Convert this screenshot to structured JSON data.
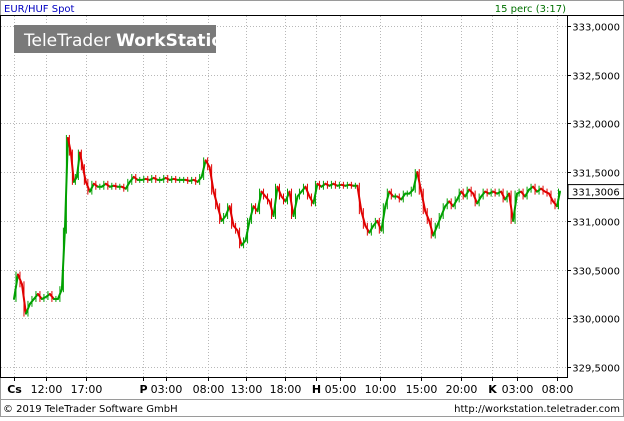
{
  "header": {
    "instrument": "EUR/HUF Spot",
    "interval": "15 perc (3:17)"
  },
  "watermark": {
    "brand_light": "TeleTrader ",
    "brand_bold": "WorkStation"
  },
  "footer": {
    "copyright": "© 2019 TeleTrader Software GmbH",
    "url": "http://workstation.teletrader.com"
  },
  "colors": {
    "up": "#00a000",
    "down": "#e00000",
    "grid": "#b8b8b8",
    "axis": "#000000",
    "header_text_left": "#0000c0",
    "header_text_right": "#007000",
    "watermark_bg": "#7a7a7a",
    "background": "#ffffff"
  },
  "chart_data": {
    "type": "line",
    "title": "EUR/HUF Spot",
    "ylim": [
      329.4,
      333.1
    ],
    "yticks": [
      {
        "value": 333.0,
        "label": "333,0000"
      },
      {
        "value": 332.5,
        "label": "332,5000"
      },
      {
        "value": 332.0,
        "label": "332,0000"
      },
      {
        "value": 331.5,
        "label": "331,5000"
      },
      {
        "value": 331.0,
        "label": "331,0000"
      },
      {
        "value": 330.5,
        "label": "330,5000"
      },
      {
        "value": 330.0,
        "label": "330,0000"
      },
      {
        "value": 329.5,
        "label": "329,5000"
      }
    ],
    "last_value": 331.3006,
    "last_label": "331,3006",
    "xlim": [
      0,
      555
    ],
    "xticks": [
      {
        "x": 8,
        "label": "Cs",
        "bold": true
      },
      {
        "x": 40,
        "label": "12:00",
        "bold": false
      },
      {
        "x": 80,
        "label": "17:00",
        "bold": false
      },
      {
        "x": 137,
        "label": "P",
        "bold": true
      },
      {
        "x": 160,
        "label": "03:00",
        "bold": false
      },
      {
        "x": 202,
        "label": "08:00",
        "bold": false
      },
      {
        "x": 240,
        "label": "13:00",
        "bold": false
      },
      {
        "x": 280,
        "label": "18:00",
        "bold": false
      },
      {
        "x": 311,
        "label": "H",
        "bold": true
      },
      {
        "x": 335,
        "label": "05:00",
        "bold": false
      },
      {
        "x": 375,
        "label": "10:00",
        "bold": false
      },
      {
        "x": 416,
        "label": "15:00",
        "bold": false
      },
      {
        "x": 456,
        "label": "20:00",
        "bold": false
      },
      {
        "x": 487,
        "label": "K",
        "bold": true
      },
      {
        "x": 512,
        "label": "03:00",
        "bold": false
      },
      {
        "x": 552,
        "label": "08:00",
        "bold": false
      }
    ],
    "series": [
      {
        "x": [
          8,
          12,
          16,
          20,
          24,
          28,
          32,
          36,
          40,
          44,
          48,
          52,
          56,
          59,
          62,
          65,
          68,
          71,
          74,
          77,
          80,
          84,
          88,
          92,
          96,
          100,
          104,
          108,
          112,
          116,
          120,
          124,
          128,
          132,
          136,
          140,
          144,
          148,
          152,
          156,
          160,
          164,
          168,
          172,
          176,
          180,
          184,
          188,
          192,
          196,
          200,
          204,
          208,
          212,
          216,
          220,
          224,
          228,
          232,
          236,
          240,
          244,
          248,
          252,
          256,
          260,
          264,
          268,
          272,
          276,
          280,
          284,
          288,
          292,
          296,
          300,
          304,
          308,
          312,
          316,
          320,
          324,
          328,
          332,
          336,
          340,
          344,
          348,
          352,
          356,
          360,
          364,
          368,
          372,
          376,
          380,
          384,
          388,
          392,
          396,
          400,
          404,
          408,
          412,
          416,
          420,
          424,
          428,
          432,
          436,
          440,
          444,
          448,
          452,
          456,
          460,
          464,
          468,
          472,
          476,
          480,
          484,
          488,
          492,
          496,
          500,
          504,
          508,
          512,
          516,
          520,
          524,
          528,
          532,
          536,
          540,
          544,
          548,
          552,
          555
        ],
        "y": [
          330.2,
          330.45,
          330.35,
          330.05,
          330.15,
          330.2,
          330.25,
          330.2,
          330.22,
          330.25,
          330.2,
          330.2,
          330.3,
          330.9,
          331.85,
          331.7,
          331.4,
          331.45,
          331.7,
          331.55,
          331.4,
          331.3,
          331.38,
          331.35,
          331.35,
          331.38,
          331.35,
          331.36,
          331.35,
          331.35,
          331.33,
          331.4,
          331.45,
          331.42,
          331.42,
          331.43,
          331.42,
          331.44,
          331.42,
          331.42,
          331.44,
          331.42,
          331.43,
          331.42,
          331.42,
          331.42,
          331.41,
          331.42,
          331.4,
          331.45,
          331.62,
          331.55,
          331.3,
          331.15,
          331.0,
          331.05,
          331.15,
          330.95,
          330.9,
          330.75,
          330.8,
          331.0,
          331.15,
          331.1,
          331.3,
          331.25,
          331.2,
          331.05,
          331.35,
          331.25,
          331.2,
          331.3,
          331.05,
          331.25,
          331.3,
          331.35,
          331.25,
          331.18,
          331.38,
          331.35,
          331.38,
          331.36,
          331.38,
          331.36,
          331.37,
          331.36,
          331.37,
          331.36,
          331.36,
          331.1,
          330.95,
          330.88,
          330.95,
          331.0,
          330.9,
          331.15,
          331.3,
          331.25,
          331.25,
          331.22,
          331.28,
          331.28,
          331.32,
          331.5,
          331.3,
          331.1,
          331.0,
          330.85,
          330.95,
          331.05,
          331.15,
          331.2,
          331.15,
          331.22,
          331.3,
          331.25,
          331.32,
          331.28,
          331.18,
          331.25,
          331.3,
          331.28,
          331.3,
          331.28,
          331.3,
          331.22,
          331.28,
          331.0,
          331.28,
          331.3,
          331.25,
          331.32,
          331.35,
          331.3,
          331.33,
          331.3,
          331.28,
          331.2,
          331.15,
          331.3
        ]
      }
    ]
  }
}
